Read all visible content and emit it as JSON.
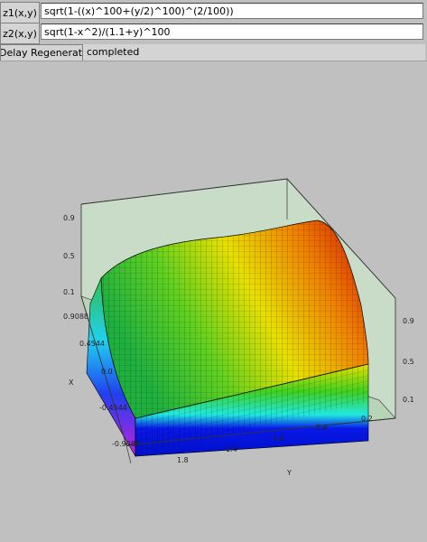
{
  "z1": {
    "label": "z1(x,y)",
    "value": "sqrt(1-((x)^100+(y/2)^100)^(2/100))"
  },
  "z2": {
    "label": "z2(x,y)",
    "value": "sqrt(1-x^2)/(1.1+y)^100"
  },
  "regen": {
    "label": "Delay Regeneration",
    "status": "completed"
  },
  "plot": {
    "z_ticks": [
      "0.9",
      "0.5",
      "0.1"
    ],
    "z_ticks_right": [
      "0.9",
      "0.5",
      "0.1"
    ],
    "x_ticks": [
      "0.9088",
      "0.4544",
      "0.0",
      "-0.4544",
      "-0.9088"
    ],
    "y_ticks": [
      "1.8",
      "1.4",
      "1.0",
      "0.6",
      "0.2"
    ],
    "x_label": "X",
    "y_label": "Y"
  },
  "colors": {
    "background": "#c0c0c0",
    "box_fill": "#c8e0c8",
    "surface_top": "#e01800",
    "surface_mid": "#f0e000",
    "surface_low": "#20c020",
    "band_cyan": "#20e8f0",
    "band_blue": "#0010e8"
  }
}
